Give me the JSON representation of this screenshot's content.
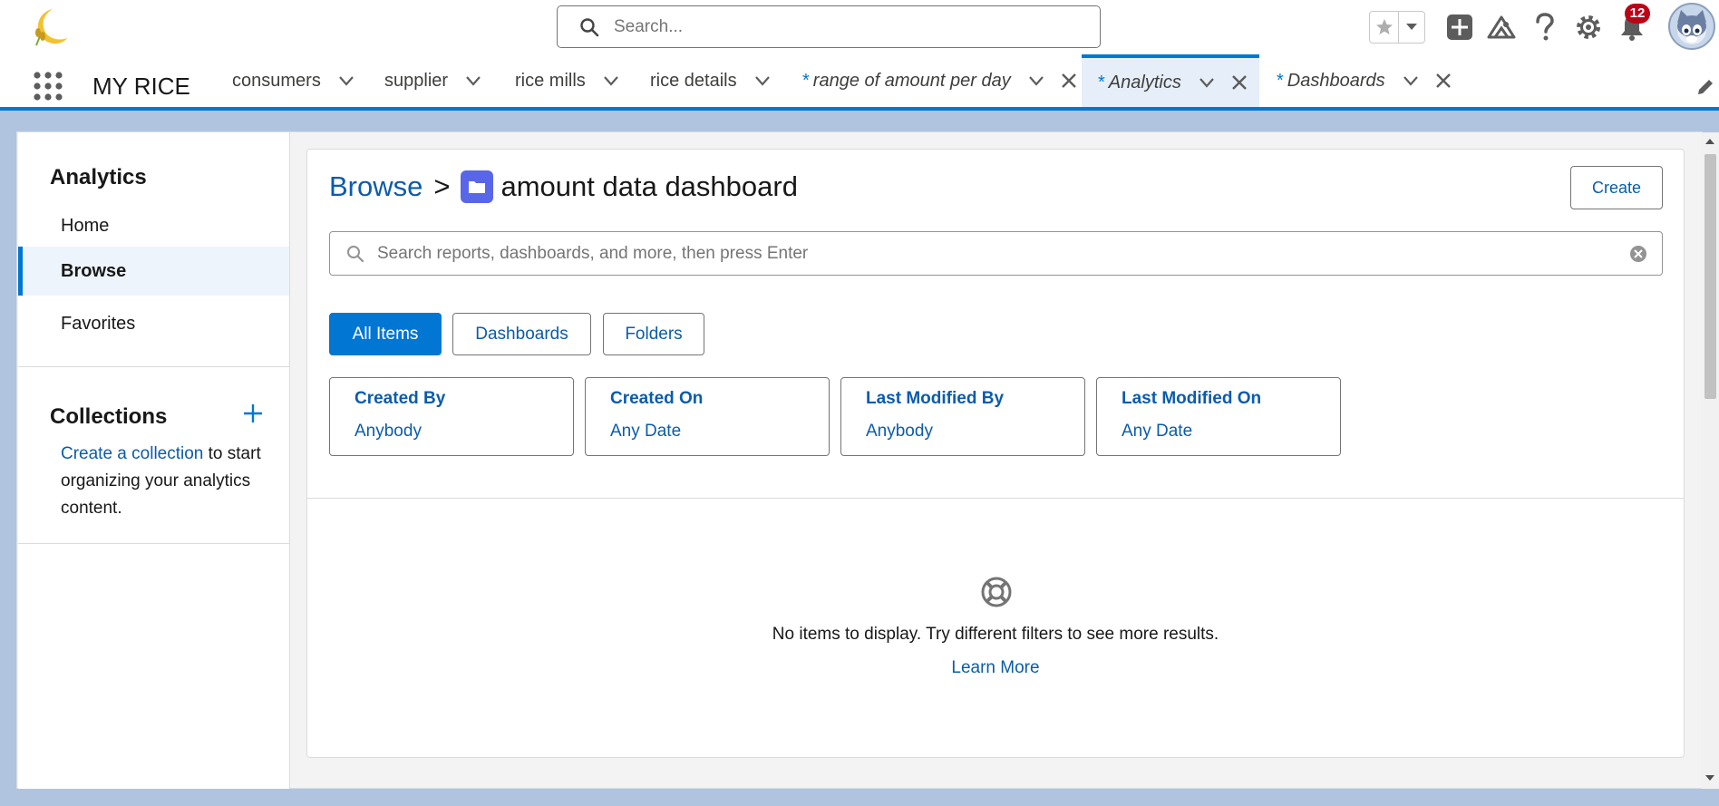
{
  "header": {
    "search_placeholder": "Search...",
    "notifications_count": "12"
  },
  "nav": {
    "app_name": "MY RICE",
    "tabs": [
      {
        "label": "consumers",
        "italic": false,
        "closable": false
      },
      {
        "label": "supplier",
        "italic": false,
        "closable": false
      },
      {
        "label": "rice mills",
        "italic": false,
        "closable": false
      },
      {
        "label": "rice details",
        "italic": false,
        "closable": false
      },
      {
        "label": "range of amount per day",
        "italic": true,
        "closable": true
      },
      {
        "label": "Analytics",
        "italic": true,
        "closable": true,
        "active": true
      },
      {
        "label": "Dashboards",
        "italic": true,
        "closable": true
      }
    ],
    "unsaved_marker": "*"
  },
  "sidebar": {
    "title": "Analytics",
    "items": [
      "Home",
      "Browse",
      "Favorites"
    ],
    "collections_title": "Collections",
    "collections_link": "Create a collection",
    "collections_text": " to start organizing your analytics content."
  },
  "main": {
    "breadcrumb_root": "Browse",
    "breadcrumb_sep": ">",
    "breadcrumb_current": "amount data dashboard",
    "create_label": "Create",
    "search_placeholder": "Search reports, dashboards, and more, then press Enter",
    "filters": [
      "All Items",
      "Dashboards",
      "Folders"
    ],
    "facets": [
      {
        "title": "Created By",
        "value": "Anybody"
      },
      {
        "title": "Created On",
        "value": "Any Date"
      },
      {
        "title": "Last Modified By",
        "value": "Anybody"
      },
      {
        "title": "Last Modified On",
        "value": "Any Date"
      }
    ],
    "empty_message": "No items to display. Try different filters to see more results.",
    "learn_more": "Learn More"
  },
  "colors": {
    "brand": "#0176d3",
    "link": "#0b5cab",
    "badge": "#ba0517",
    "folder": "#5867e8"
  }
}
